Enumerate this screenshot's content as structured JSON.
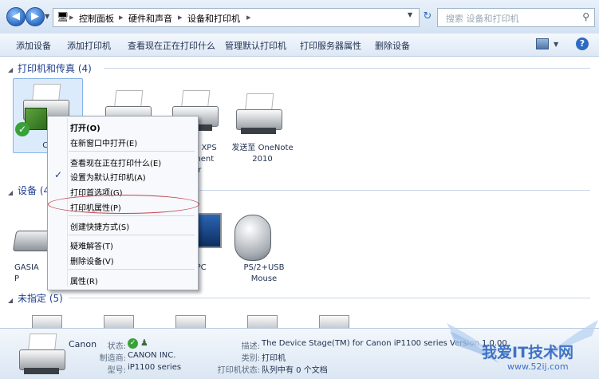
{
  "address_bar": {
    "path": [
      "控制面板",
      "硬件和声音",
      "设备和打印机"
    ],
    "search_placeholder": "搜索 设备和打印机"
  },
  "toolbar": {
    "items": [
      "添加设备",
      "添加打印机",
      "查看现在正在打印什么",
      "管理默认打印机",
      "打印服务器属性",
      "删除设备"
    ]
  },
  "sections": {
    "printers": {
      "title": "打印机和传真 (4)",
      "devices": [
        {
          "label": "Can"
        },
        {
          "label": ""
        },
        {
          "label": "ft XPS\nment\ner"
        },
        {
          "label": "发送至 OneNote\n2010"
        }
      ]
    },
    "devices": {
      "title": "设备 (4",
      "devices": [
        {
          "label": "GASIA\nP"
        },
        {
          "label": "-PC"
        },
        {
          "label": "PS/2+USB\nMouse"
        }
      ]
    },
    "unspecified": {
      "title": "未指定 (5)"
    }
  },
  "context_menu": {
    "items": [
      {
        "label": "打开(O)",
        "bold": true,
        "checked": false
      },
      {
        "label": "在新窗口中打开(E)",
        "checked": false
      },
      {
        "label": "查看现在正在打印什么(E)",
        "checked": false
      },
      {
        "label": "设置为默认打印机(A)",
        "checked": true
      },
      {
        "label": "打印首选项(G)",
        "checked": false
      },
      {
        "label": "打印机属性(P)",
        "checked": false,
        "circled": true
      },
      {
        "label": "创建快捷方式(S)",
        "checked": false
      },
      {
        "label": "疑难解答(T)",
        "checked": false
      },
      {
        "label": "删除设备(V)",
        "checked": false
      },
      {
        "label": "属性(R)",
        "checked": false
      }
    ]
  },
  "details": {
    "name": "Canon",
    "state_label": "状态:",
    "manufacturer_label": "制造商:",
    "manufacturer": "CANON INC.",
    "model_label": "型号:",
    "model": "iP1100 series",
    "description_label": "描述:",
    "description": "The Device Stage(TM) for Canon iP1100 series Version 1.0.00",
    "category_label": "类别:",
    "category": "打印机",
    "printer_status_label": "打印机状态:",
    "printer_status": "队列中有 0 个文档"
  },
  "watermark": {
    "cn": "我爱IT技术网",
    "url": "www.52ij.com"
  },
  "colors": {
    "section_title": "#1e3f8f",
    "menu_bg": "#f7f9fc",
    "highlight_ring": "#c2414f",
    "check_green": "#3aa13a"
  },
  "icons": [
    "back-icon",
    "forward-icon",
    "control-panel-icon",
    "refresh-icon",
    "search-icon",
    "view-icon",
    "help-icon",
    "printer-icon",
    "check-icon",
    "users-icon",
    "keyboard-icon",
    "laptop-icon",
    "mouse-icon",
    "device-icon"
  ]
}
